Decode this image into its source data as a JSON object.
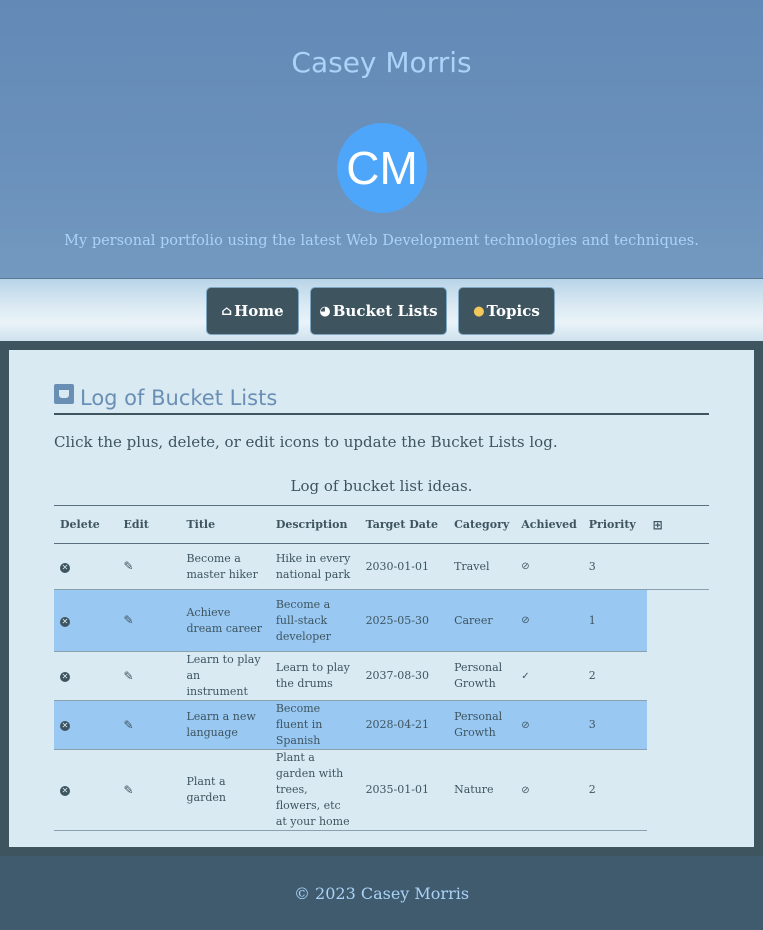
{
  "header": {
    "title": "Casey Morris",
    "avatar_initials": "CM",
    "tagline": "My personal portfolio using the latest Web Development technologies and techniques."
  },
  "nav": {
    "home": {
      "icon": "home-icon",
      "label": "Home"
    },
    "bucket": {
      "icon": "bucket-icon",
      "label": "Bucket Lists"
    },
    "topics": {
      "icon": "sun-icon",
      "label": "Topics"
    }
  },
  "main": {
    "section_title": "Log of Bucket Lists",
    "instruction": "Click the plus, delete, or edit icons to update the Bucket Lists log.",
    "caption": "Log of bucket list ideas.",
    "columns": [
      "Delete",
      "Edit",
      "Title",
      "Description",
      "Target Date",
      "Category",
      "Achieved",
      "Priority"
    ],
    "rows": [
      {
        "title": "Become a master hiker",
        "description": "Hike in every national park",
        "target_date": "2030-01-01",
        "category": "Travel",
        "achieved": "no",
        "priority": "3"
      },
      {
        "title": "Achieve dream career",
        "description": "Become a full-stack developer",
        "target_date": "2025-05-30",
        "category": "Career",
        "achieved": "no",
        "priority": "1"
      },
      {
        "title": "Learn to play an instrument",
        "description": "Learn to play the drums",
        "target_date": "2037-08-30",
        "category": "Personal Growth",
        "achieved": "yes",
        "priority": "2"
      },
      {
        "title": "Learn a new language",
        "description": "Become fluent in Spanish",
        "target_date": "2028-04-21",
        "category": "Personal Growth",
        "achieved": "no",
        "priority": "3"
      },
      {
        "title": "Plant a garden",
        "description": "Plant a garden with trees, flowers, etc at your home",
        "target_date": "2035-01-01",
        "category": "Nature",
        "achieved": "no",
        "priority": "2"
      }
    ]
  },
  "footer": {
    "copyright": "© 2023 Casey Morris"
  },
  "colors": {
    "header_bg": "#6389b6",
    "title_text": "#a9d3f7",
    "avatar_bg": "#4ea6fb",
    "nav_button_bg": "#3e5560",
    "content_bg": "#d9eaf2",
    "row_highlight": "#99c8f2",
    "footer_bg": "#405a6e"
  }
}
